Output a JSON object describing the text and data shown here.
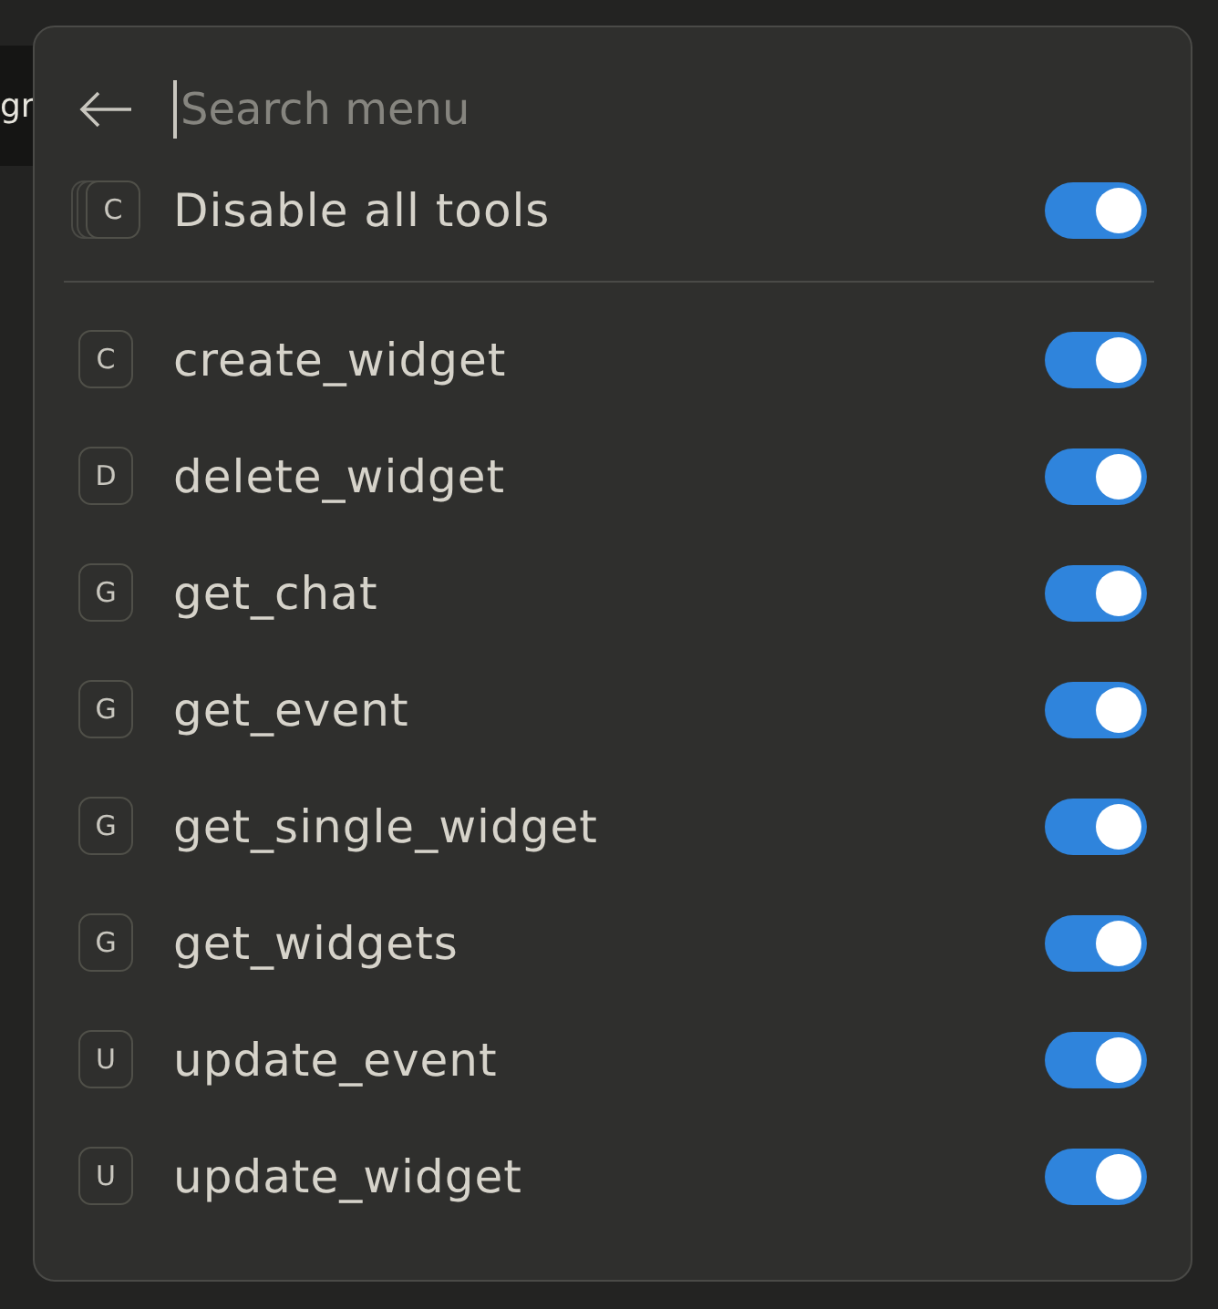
{
  "background": {
    "text": "gr"
  },
  "search": {
    "placeholder": "Search menu"
  },
  "disable_all": {
    "badge": "C",
    "label": "Disable all tools",
    "on": true
  },
  "tools": [
    {
      "badge": "C",
      "label": "create_widget",
      "on": true
    },
    {
      "badge": "D",
      "label": "delete_widget",
      "on": true
    },
    {
      "badge": "G",
      "label": "get_chat",
      "on": true
    },
    {
      "badge": "G",
      "label": "get_event",
      "on": true
    },
    {
      "badge": "G",
      "label": "get_single_widget",
      "on": true
    },
    {
      "badge": "G",
      "label": "get_widgets",
      "on": true
    },
    {
      "badge": "U",
      "label": "update_event",
      "on": true
    },
    {
      "badge": "U",
      "label": "update_widget",
      "on": true
    }
  ]
}
